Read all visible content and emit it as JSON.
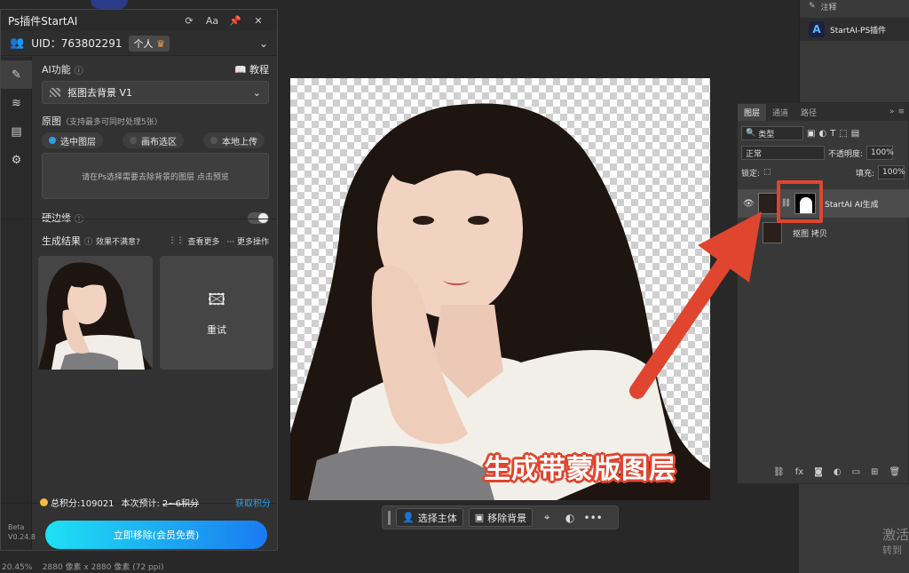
{
  "plugin": {
    "title": "Ps插件StartAI",
    "uid_label": "UID：763802291",
    "account_badge": "个人",
    "ai_function_label": "AI功能",
    "tutorial_label": "教程",
    "function_select": "抠图去背景 V1",
    "source_label": "原图",
    "source_hint": "（支持最多可同时处理5张）",
    "source_options": [
      "选中图层",
      "画布选区",
      "本地上传"
    ],
    "selected_option": "选中图层",
    "drop_hint": "请在Ps选择需要去除背景的图层 点击预览",
    "hard_edge_label": "硬边缘",
    "results_label": "生成结果",
    "unsatisfied_label": "效果不满意?",
    "see_more_label": "查看更多",
    "more_actions_label": "更多操作",
    "retry_label": "重试",
    "total_points": "总积分:109021",
    "estimate_label": "本次预计:",
    "estimate_value": "2~6积分",
    "get_points_label": "获取积分",
    "cta_label": "立即移除(会员免费)",
    "beta_label": "Beta",
    "version": "V0.24.8"
  },
  "context_bar": {
    "select_subject": "选择主体",
    "remove_background": "移除背景"
  },
  "status_bar": {
    "zoom": "20.45%",
    "doc_info": "2880 像素 x 2880 像素 (72 ppi)"
  },
  "right_top": {
    "item1": "注释",
    "item2": "StartAI-PS插件"
  },
  "layers_panel": {
    "tabs": [
      "图层",
      "通道",
      "路径"
    ],
    "kind_select": "类型",
    "blend_mode": "正常",
    "opacity_label": "不透明度:",
    "opacity_value": "100%",
    "lock_label": "锁定:",
    "fill_label": "填充:",
    "fill_value": "100%",
    "layers": [
      {
        "name": "StartAI AI生成"
      },
      {
        "name": "抠图 拷贝"
      }
    ]
  },
  "watermark": {
    "line1": "激活",
    "line2": "转到"
  },
  "annotation": {
    "text": "生成带蒙版图层"
  },
  "colors": {
    "accent": "#e0452f",
    "cta_start": "#1ee1f4",
    "cta_end": "#1a7bf2"
  }
}
